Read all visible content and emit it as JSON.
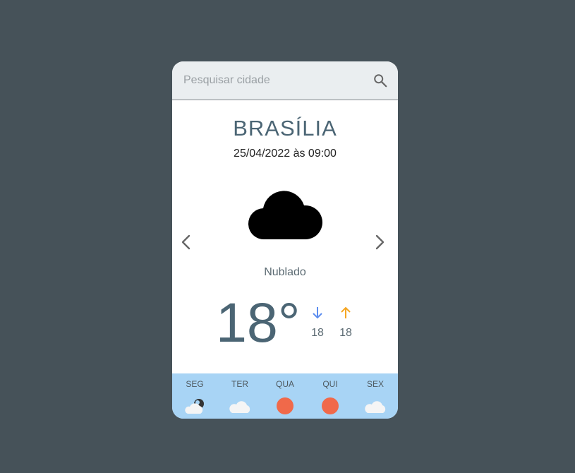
{
  "search": {
    "placeholder": "Pesquisar cidade",
    "value": ""
  },
  "location": {
    "city": "BRASÍLIA",
    "datetime": "25/04/2022 às 09:00"
  },
  "current": {
    "condition": "Nublado",
    "icon": "cloud-icon",
    "temperature": "18°",
    "min": "18",
    "max": "18"
  },
  "forecast": [
    {
      "day": "SEG",
      "icon": "cloud-moon-icon"
    },
    {
      "day": "TER",
      "icon": "cloud-icon"
    },
    {
      "day": "QUA",
      "icon": "sun-icon"
    },
    {
      "day": "QUI",
      "icon": "sun-icon"
    },
    {
      "day": "SEX",
      "icon": "cloud-icon"
    }
  ],
  "colors": {
    "background": "#465259",
    "accent_text": "#4b6574",
    "min_arrow": "#5b8def",
    "max_arrow": "#f5a623",
    "forecast_bar": "#a8d4f5",
    "sun": "#f0694a"
  }
}
